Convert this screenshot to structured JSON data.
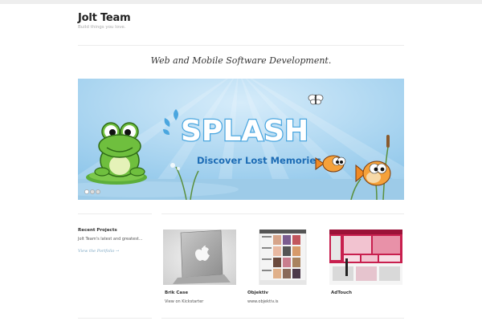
{
  "site": {
    "title": "Jolt Team",
    "description": "Build things you love."
  },
  "tagline": "Web and Mobile Software Development.",
  "slider": {
    "logo_text": "SPLASH",
    "banner_text": "Discover Lost Memories",
    "dots": 3
  },
  "sidebar": {
    "heading": "Recent Projects",
    "text": "Jolt Team's latest and greatest...",
    "link": "View the Portfolio →"
  },
  "projects": [
    {
      "name": "Brik Case",
      "subtitle": "View on Kickstarter"
    },
    {
      "name": "Objektiv",
      "subtitle": "www.objektiv.is"
    },
    {
      "name": "AdTouch",
      "subtitle": ""
    }
  ],
  "colors": {
    "sky": "#a9d3ee",
    "splash_blue": "#4aa6df",
    "banner_text": "#1d6cb5",
    "link": "#7aa6c2",
    "adtouch": "#c81f4e"
  }
}
